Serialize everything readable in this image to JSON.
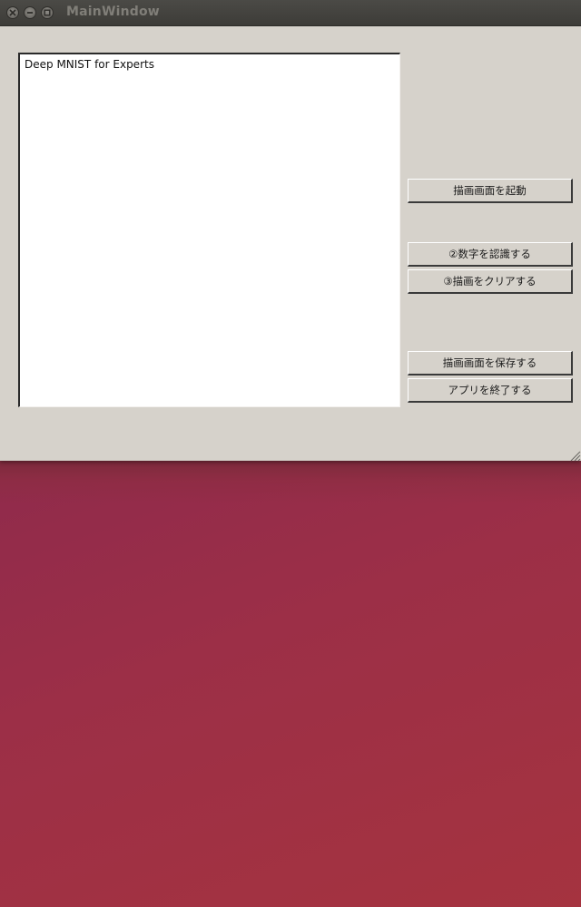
{
  "window": {
    "title": "MainWindow"
  },
  "main": {
    "text_area": "Deep MNIST for Experts",
    "buttons": {
      "start_drawing": "描画画面を起動",
      "recognize": "②数字を認識する",
      "clear": "③描画をクリアする",
      "save": "描画画面を保存する",
      "quit": "アプリを終了する"
    }
  },
  "icons": {
    "close": "close-icon",
    "minimize": "minimize-icon",
    "maximize": "maximize-icon",
    "resize": "resize-grip-icon"
  },
  "colors": {
    "window_bg": "#d6d2cb",
    "titlebar": "#3d3c38",
    "desktop_left": "#7e2352",
    "desktop_right": "#a5333f"
  }
}
